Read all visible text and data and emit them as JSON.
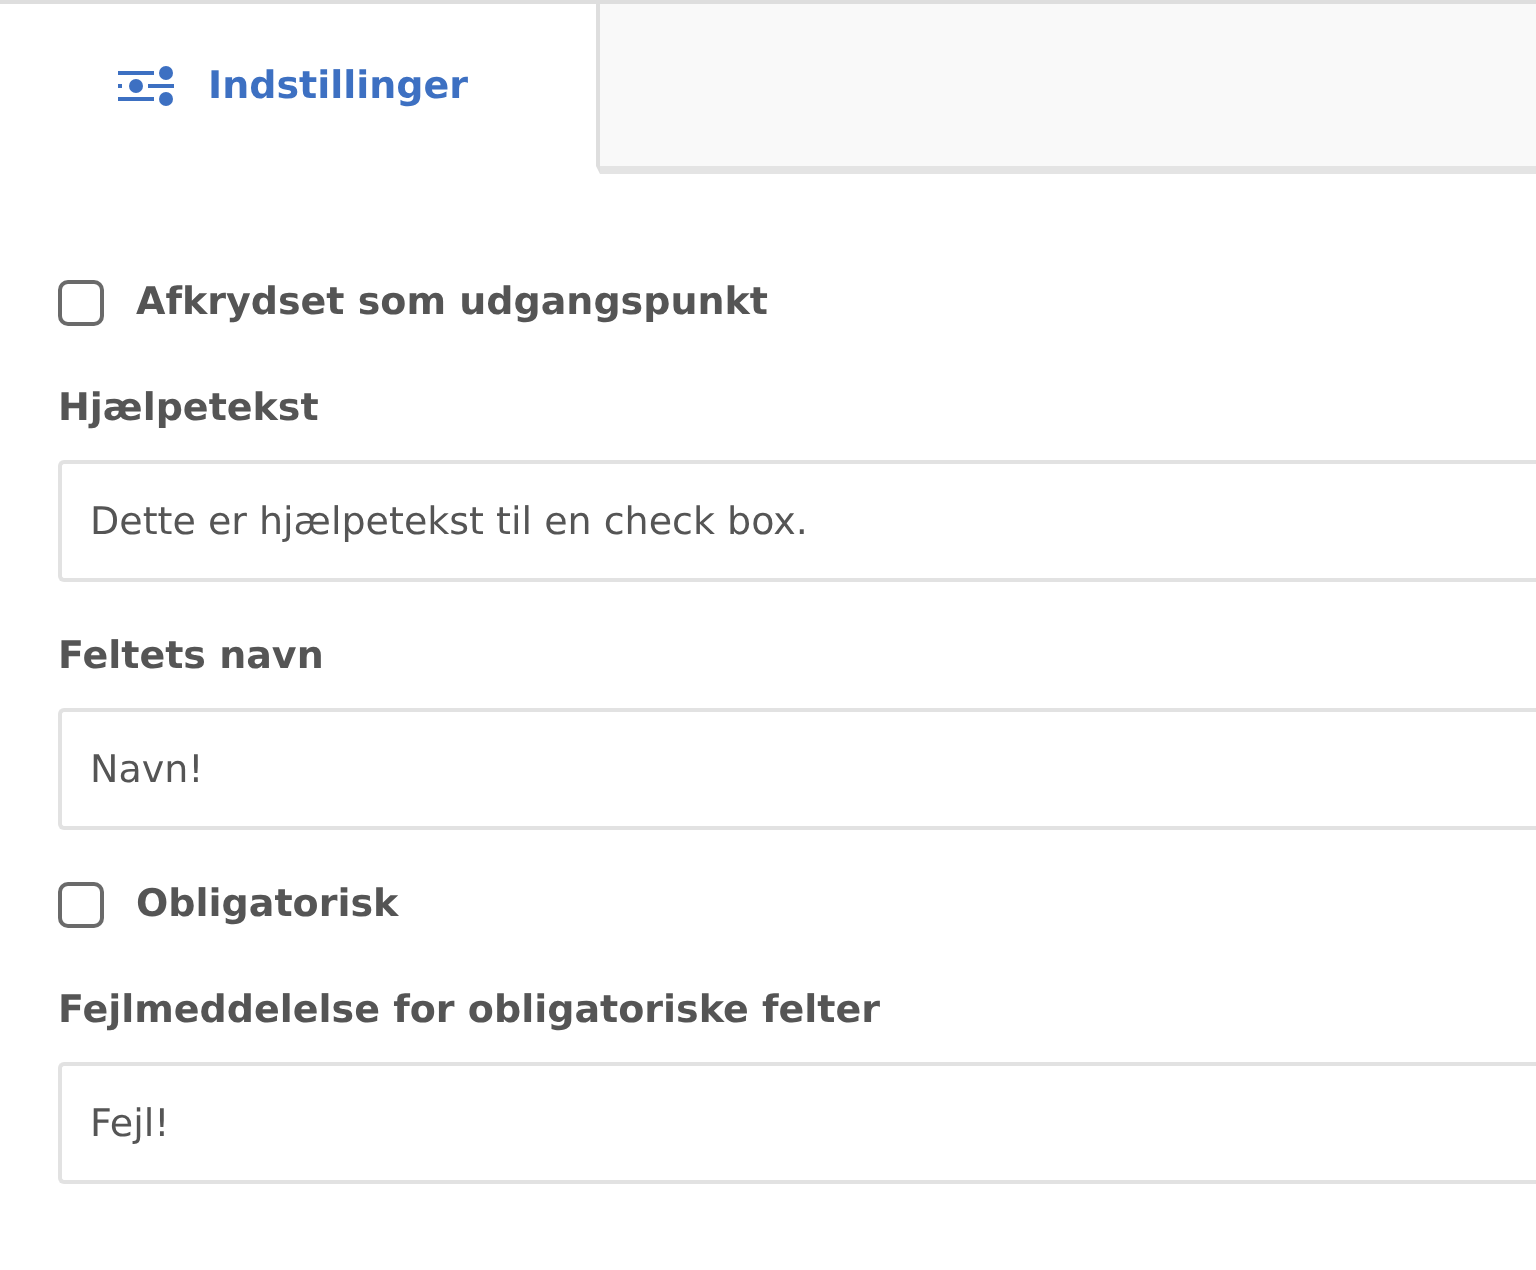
{
  "tabs": [
    {
      "label": "Indstillinger",
      "selected": true
    }
  ],
  "fields": [
    {
      "kind": "checkbox",
      "label": "Afkrydset som udgangspunkt",
      "checked": false
    },
    {
      "kind": "text",
      "label": "Hjælpetekst",
      "value": "Dette er hjælpetekst til en check box."
    },
    {
      "kind": "text",
      "label": "Feltets navn",
      "value": "Navn!"
    },
    {
      "kind": "checkbox",
      "label": "Obligatorisk",
      "checked": false
    },
    {
      "kind": "text",
      "label": "Fejlmeddelelse for obligatoriske felter",
      "value": "Fejl!"
    }
  ]
}
